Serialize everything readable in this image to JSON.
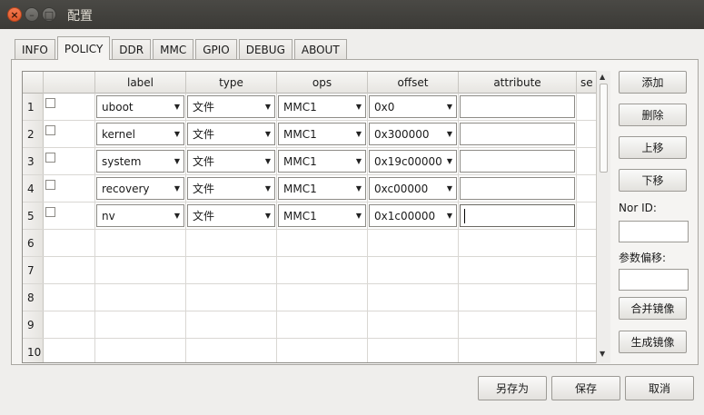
{
  "window": {
    "title": "配置"
  },
  "tabs": [
    "INFO",
    "POLICY",
    "DDR",
    "MMC",
    "GPIO",
    "DEBUG",
    "ABOUT"
  ],
  "active_tab": "POLICY",
  "table": {
    "headers": [
      "label",
      "type",
      "ops",
      "offset",
      "attribute",
      "se"
    ],
    "row_numbers": [
      "1",
      "2",
      "3",
      "4",
      "5",
      "6",
      "7",
      "8",
      "9",
      "10"
    ],
    "rows": [
      {
        "label": "uboot",
        "type": "文件",
        "ops": "MMC1",
        "offset": "0x0"
      },
      {
        "label": "kernel",
        "type": "文件",
        "ops": "MMC1",
        "offset": "0x300000"
      },
      {
        "label": "system",
        "type": "文件",
        "ops": "MMC1",
        "offset": "0x19c00000"
      },
      {
        "label": "recovery",
        "type": "文件",
        "ops": "MMC1",
        "offset": "0xc00000"
      },
      {
        "label": "nv",
        "type": "文件",
        "ops": "MMC1",
        "offset": "0x1c00000"
      }
    ]
  },
  "side": {
    "add": "添加",
    "delete": "删除",
    "up": "上移",
    "down": "下移",
    "nor_id_label": "Nor ID:",
    "param_offset_label": "参数偏移:",
    "merge": "合并镜像",
    "generate": "生成镜像"
  },
  "footer": {
    "save_as": "另存为",
    "save": "保存",
    "cancel": "取消"
  },
  "icons": {
    "close": "close-icon",
    "minimize": "minimize-icon",
    "maximize": "maximize-icon",
    "dropdown": "chevron-down-icon"
  },
  "colors": {
    "close_button": "#e0582a",
    "titlebar": "#3b3a36"
  }
}
